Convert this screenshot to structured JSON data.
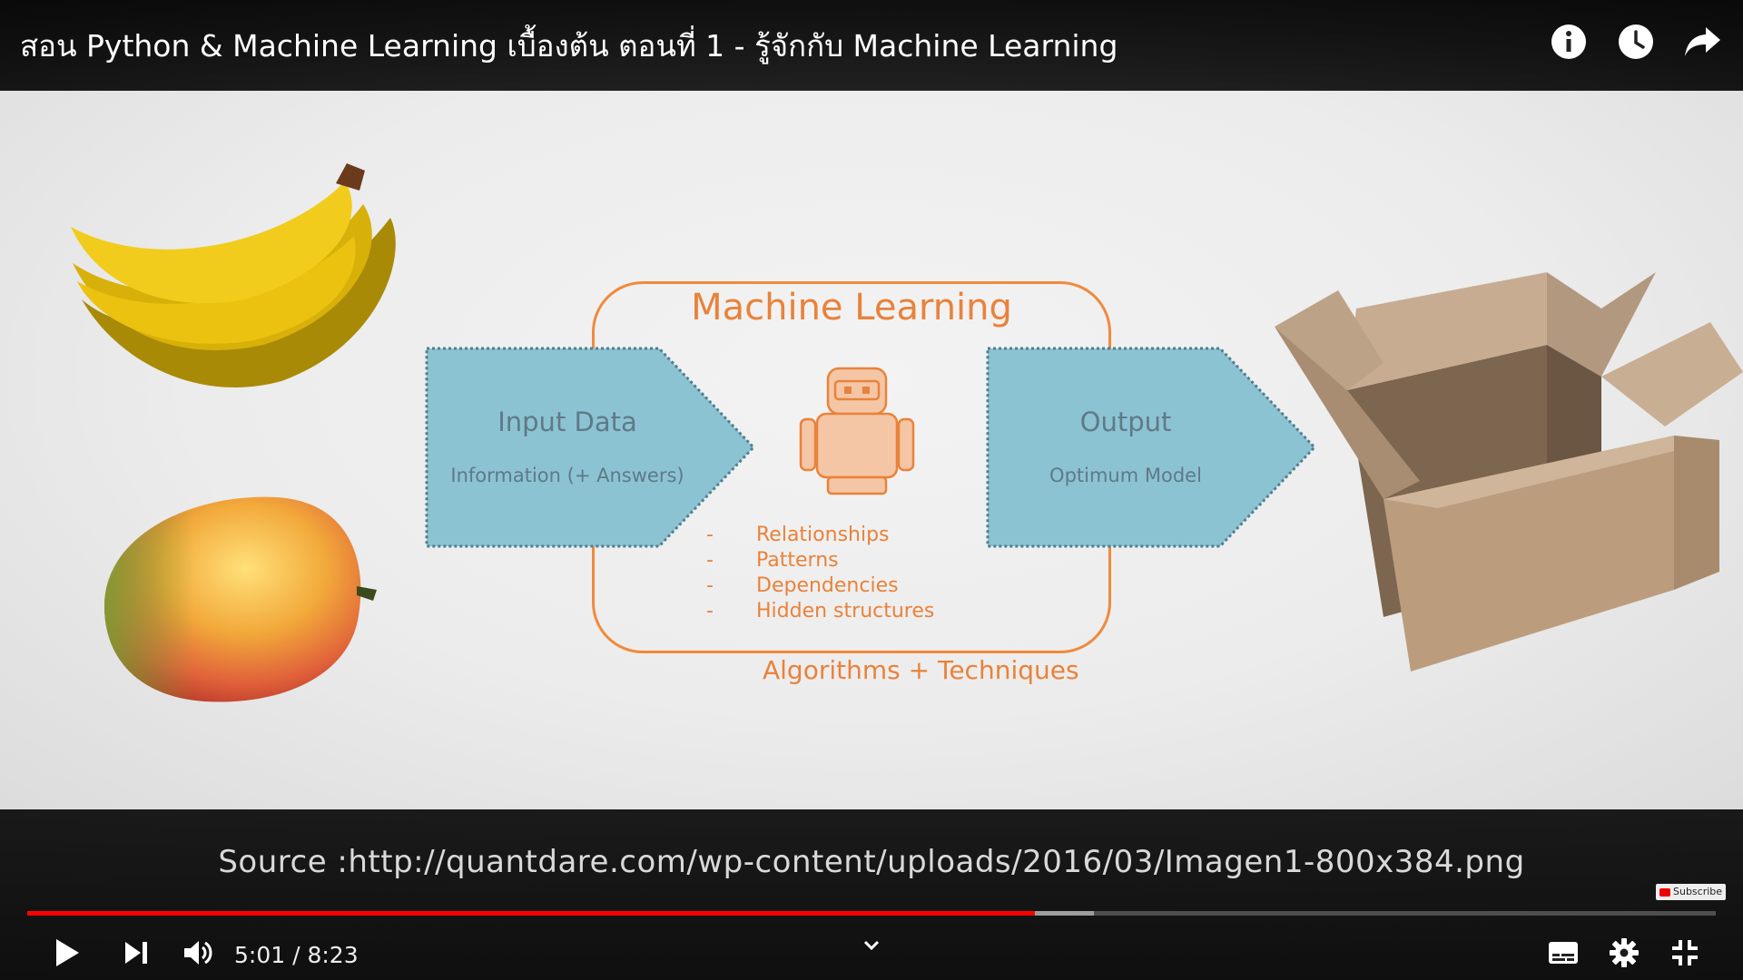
{
  "video": {
    "title": "สอน Python & Machine Learning เบื้องต้น ตอนที่ 1 - รู้จักกับ Machine Learning"
  },
  "top_icons": [
    "info-icon",
    "watch-later-clock-icon",
    "share-icon"
  ],
  "slide": {
    "ml_title": "Machine Learning",
    "input": {
      "title": "Input Data",
      "subtitle": "Information (+ Answers)"
    },
    "output": {
      "title": "Output",
      "subtitle": "Optimum Model"
    },
    "bullets": [
      {
        "dash": "-",
        "text": "Relationships"
      },
      {
        "dash": "-",
        "text": "Patterns"
      },
      {
        "dash": "-",
        "text": "Dependencies"
      },
      {
        "dash": "-",
        "text": "Hidden structures"
      }
    ],
    "algorithms": "Algorithms + Techniques",
    "source": "Source :http://quantdare.com/wp-content/uploads/2016/03/Imagen1-800x384.png"
  },
  "watermark": {
    "label": "Subscribe"
  },
  "player": {
    "time_display": "5:01 / 8:23",
    "played_fraction": 0.5969,
    "buffered_fraction": 0.6315
  },
  "colors": {
    "accent": "#f08a3c",
    "progress_played": "#ff0000",
    "arrow_fill": "#8cc3d3"
  }
}
